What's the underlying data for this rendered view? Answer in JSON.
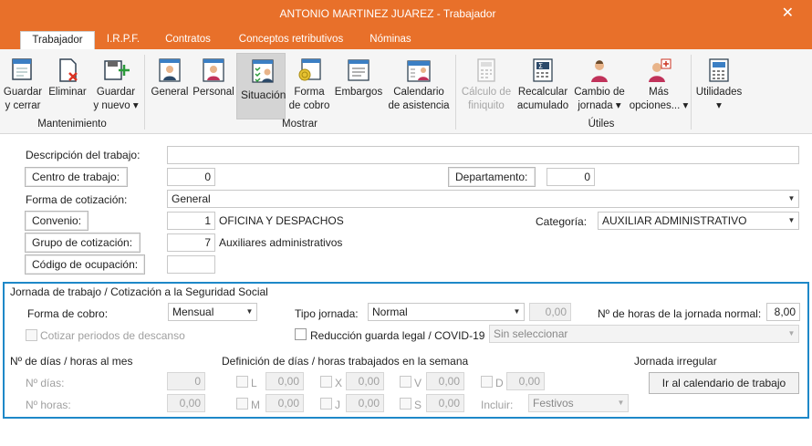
{
  "window": {
    "title": "ANTONIO MARTINEZ JUAREZ - Trabajador",
    "close_symbol": "✕"
  },
  "tabs": [
    "Trabajador",
    "I.R.P.F.",
    "Contratos",
    "Conceptos retributivos",
    "Nóminas"
  ],
  "ribbon": {
    "buttons": {
      "guardar_cerrar": [
        "Guardar",
        "y cerrar"
      ],
      "eliminar": [
        "Eliminar",
        ""
      ],
      "guardar_nuevo": [
        "Guardar",
        "y nuevo ▾"
      ],
      "general": [
        "General",
        ""
      ],
      "personal": [
        "Personal",
        ""
      ],
      "situacion": [
        "Situación",
        ""
      ],
      "forma_cobro": [
        "Forma",
        "de cobro"
      ],
      "embargos": [
        "Embargos",
        ""
      ],
      "calendario": [
        "Calendario",
        "de asistencia"
      ],
      "calculo": [
        "Cálculo de",
        "finiquito"
      ],
      "recalcular": [
        "Recalcular",
        "acumulado"
      ],
      "cambio": [
        "Cambio de",
        "jornada ▾"
      ],
      "mas": [
        "Más",
        "opciones... ▾"
      ],
      "utilidades": [
        "Utilidades",
        "▾"
      ]
    },
    "groups": {
      "mantenimiento": "Mantenimiento",
      "mostrar": "Mostrar",
      "utiles": "Útiles"
    }
  },
  "form": {
    "descripcion_label": "Descripción del trabajo:",
    "descripcion_value": "",
    "centro_label": "Centro de trabajo:",
    "centro_value": "0",
    "departamento_label": "Departamento:",
    "departamento_value": "0",
    "forma_cot_label": "Forma de cotización:",
    "forma_cot_value": "General",
    "convenio_label": "Convenio:",
    "convenio_code": "1",
    "convenio_name": "OFICINA Y DESPACHOS",
    "categoria_label": "Categoría:",
    "categoria_value": "AUXILIAR ADMINISTRATIVO",
    "grupo_label": "Grupo de cotización:",
    "grupo_code": "7",
    "grupo_name": "Auxiliares administrativos",
    "codigo_label": "Código de ocupación:",
    "codigo_value": ""
  },
  "jornada": {
    "title": "Jornada de trabajo / Cotización a la Seguridad Social",
    "forma_cobro_label": "Forma de cobro:",
    "forma_cobro_value": "Mensual",
    "tipo_label": "Tipo jornada:",
    "tipo_value": "Normal",
    "tipo_num": "0,00",
    "horas_label": "Nº de horas de la jornada normal:",
    "horas_value": "8,00",
    "cotizar_label": "Cotizar periodos de descanso",
    "reduccion_label": "Reducción guarda legal / COVID-19",
    "sin_seleccionar": "Sin seleccionar",
    "dias_section": "Nº de días / horas al mes",
    "definicion_section": "Definición de días / horas trabajados en la semana",
    "irregular_section": "Jornada irregular",
    "n_dias_label": "Nº días:",
    "n_dias_value": "0",
    "n_horas_label": "Nº horas:",
    "n_horas_value": "0,00",
    "days_row1": [
      {
        "d": "L",
        "v": "0,00"
      },
      {
        "d": "X",
        "v": "0,00"
      },
      {
        "d": "V",
        "v": "0,00"
      },
      {
        "d": "D",
        "v": "0,00"
      }
    ],
    "days_row2": [
      {
        "d": "M",
        "v": "0,00"
      },
      {
        "d": "J",
        "v": "0,00"
      },
      {
        "d": "S",
        "v": "0,00"
      }
    ],
    "incluir_label": "Incluir:",
    "incluir_value": "Festivos",
    "calendario_button": "Ir al calendario de trabajo"
  },
  "colors": {
    "accent": "#e8702a",
    "frame": "#1e88c8"
  },
  "icons": [
    "save-close-icon",
    "delete-icon",
    "save-new-icon",
    "worker-general-icon",
    "worker-personal-icon",
    "worker-situation-icon",
    "payment-icon",
    "seizure-icon",
    "calendar-icon",
    "settlement-icon",
    "recalc-icon",
    "schedule-change-icon",
    "more-options-icon",
    "utilities-icon"
  ]
}
